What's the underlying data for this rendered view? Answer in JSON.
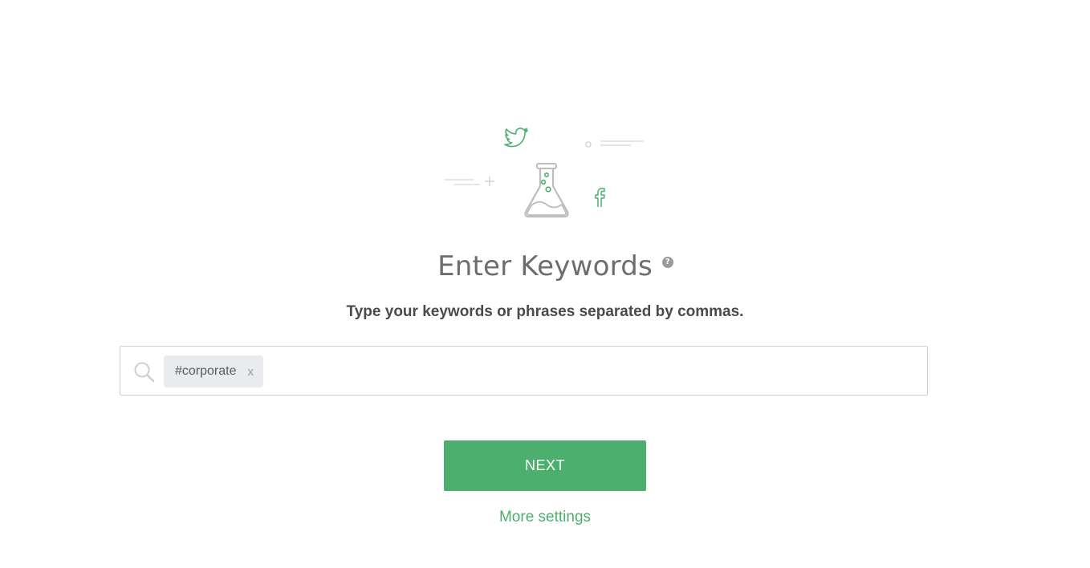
{
  "hero": {
    "icons": [
      "twitter-icon",
      "flask-icon",
      "facebook-icon"
    ]
  },
  "heading": {
    "title": "Enter Keywords",
    "help_icon_glyph": "?"
  },
  "subtitle": "Type your keywords or phrases separated by commas.",
  "keyword_input": {
    "icon": "search-icon",
    "value": "",
    "tags": [
      {
        "label": "#corporate",
        "remove_glyph": "x"
      }
    ]
  },
  "actions": {
    "next_label": "NEXT",
    "more_settings_label": "More settings"
  },
  "colors": {
    "accent": "#4caf6e",
    "title": "#6d6d6d",
    "subtitle": "#4a4a4a",
    "chip_bg": "#e9ebee",
    "border": "#cfcfcf"
  }
}
